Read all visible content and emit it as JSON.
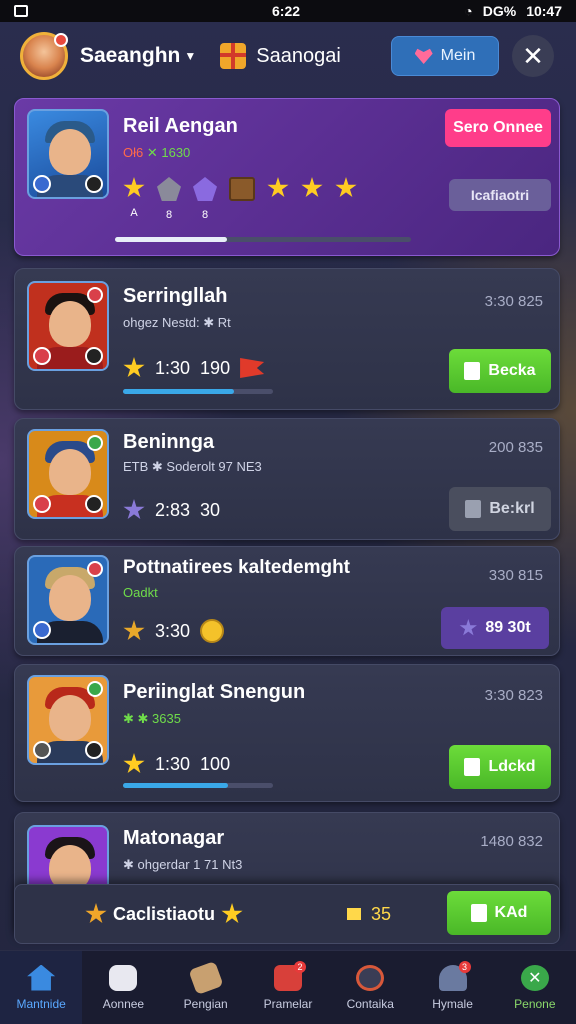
{
  "status_bar": {
    "time_center": "6:22",
    "battery": "DG%",
    "time_right": "10:47"
  },
  "header": {
    "user_name": "Saeanghn",
    "guild_name": "Saanogai",
    "main_button_label": "Mein",
    "close_label": "✕"
  },
  "featured": {
    "title": "Reil Aengan",
    "subtitle_a": "Oł6",
    "subtitle_b": "✕ 1630",
    "button_label": "Sero Onnee",
    "secondary_button_label": "Icafiaotri",
    "rewards": [
      {
        "kind": "star",
        "label": "A"
      },
      {
        "kind": "gem-gray",
        "label": "8"
      },
      {
        "kind": "gem-purple",
        "label": "8"
      },
      {
        "kind": "chest",
        "label": ""
      },
      {
        "kind": "star",
        "label": ""
      },
      {
        "kind": "star",
        "label": ""
      },
      {
        "kind": "star",
        "label": ""
      }
    ],
    "progress": 0.38
  },
  "entries": [
    {
      "title": "Serringllah",
      "subtitle": "ohgez Nestd: ✱ Rt",
      "time": "3:30 825",
      "stat_a": "1:30",
      "stat_b": "190",
      "button_label": "Becka",
      "button_style": "green",
      "progress": 0.74,
      "colors": {
        "bg": "#c0301e",
        "hair": "#1a1210",
        "shirt": "#9a1c1c"
      }
    },
    {
      "title": "Beninnga",
      "subtitle": "ETB ✱ Soderolt 97 NE3",
      "time": "200 835",
      "stat_a": "2:83",
      "stat_b": "30",
      "button_label": "Be:krl",
      "button_style": "gray",
      "colors": {
        "bg": "#d88a1a",
        "hair": "#2a4a8a",
        "shirt": "#c83020"
      }
    },
    {
      "title": "Pottnatirees kaltedemght",
      "subtitle": "Oadkt",
      "time": "330 815",
      "stat_a": "3:30",
      "stat_b": "",
      "button_label": "89 30t",
      "button_style": "violet",
      "colors": {
        "bg": "#2a6ab8",
        "hair": "#c8a86a",
        "shirt": "#1a2030"
      }
    },
    {
      "title": "Periinglat Snengun",
      "subtitle": "✱ ✱ 3635",
      "time": "3:30 823",
      "stat_a": "1:30",
      "stat_b": "100",
      "button_label": "Ldckd",
      "button_style": "green",
      "progress": 0.7,
      "colors": {
        "bg": "#e89a3a",
        "hair": "#b8281a",
        "shirt": "#2a3a5a"
      }
    },
    {
      "title": "Matonagar",
      "subtitle": "✱ ohgerdar 1 71 Nt3",
      "time": "1480 832",
      "colors": {
        "bg": "#8a3ad0",
        "hair": "#1a1418",
        "shirt": "#3a2050"
      }
    }
  ],
  "bottom_banner": {
    "label": "Caclistiaotu",
    "count": "35",
    "button_label": "KAd"
  },
  "nav": [
    {
      "label": "Mantnide",
      "icon": "home-icon",
      "active": true
    },
    {
      "label": "Aonnee",
      "icon": "dice-icon",
      "active": false
    },
    {
      "label": "Pengian",
      "icon": "scroll-icon",
      "active": false
    },
    {
      "label": "Pramelar",
      "icon": "chest-icon",
      "badge": "2",
      "active": false
    },
    {
      "label": "Contaika",
      "icon": "bomb-icon",
      "active": false
    },
    {
      "label": "Hymale",
      "icon": "helmet-icon",
      "badge": "3",
      "active": false
    },
    {
      "label": "Penone",
      "icon": "check-icon",
      "active": false
    }
  ]
}
